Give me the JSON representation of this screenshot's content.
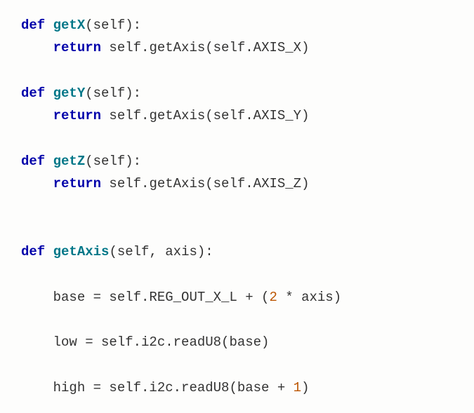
{
  "code": {
    "l1_def": "def",
    "l1_name": "getX",
    "l1_params": "(self):",
    "l2_return": "return",
    "l2_expr": " self.getAxis(self.AXIS_X)",
    "l3_def": "def",
    "l3_name": "getY",
    "l3_params": "(self):",
    "l4_return": "return",
    "l4_expr": " self.getAxis(self.AXIS_Y)",
    "l5_def": "def",
    "l5_name": "getZ",
    "l5_params": "(self):",
    "l6_return": "return",
    "l6_expr": " self.getAxis(self.AXIS_Z)",
    "l7_def": "def",
    "l7_name": "getAxis",
    "l7_params": "(self, axis):",
    "l8_pre": "    base = self.REG_OUT_X_L + (",
    "l8_num": "2",
    "l8_post": " * axis)",
    "l9": "    low = self.i2c.readU8(base)",
    "l10_pre": "    high = self.i2c.readU8(base + ",
    "l10_num": "1",
    "l10_post": ")"
  }
}
